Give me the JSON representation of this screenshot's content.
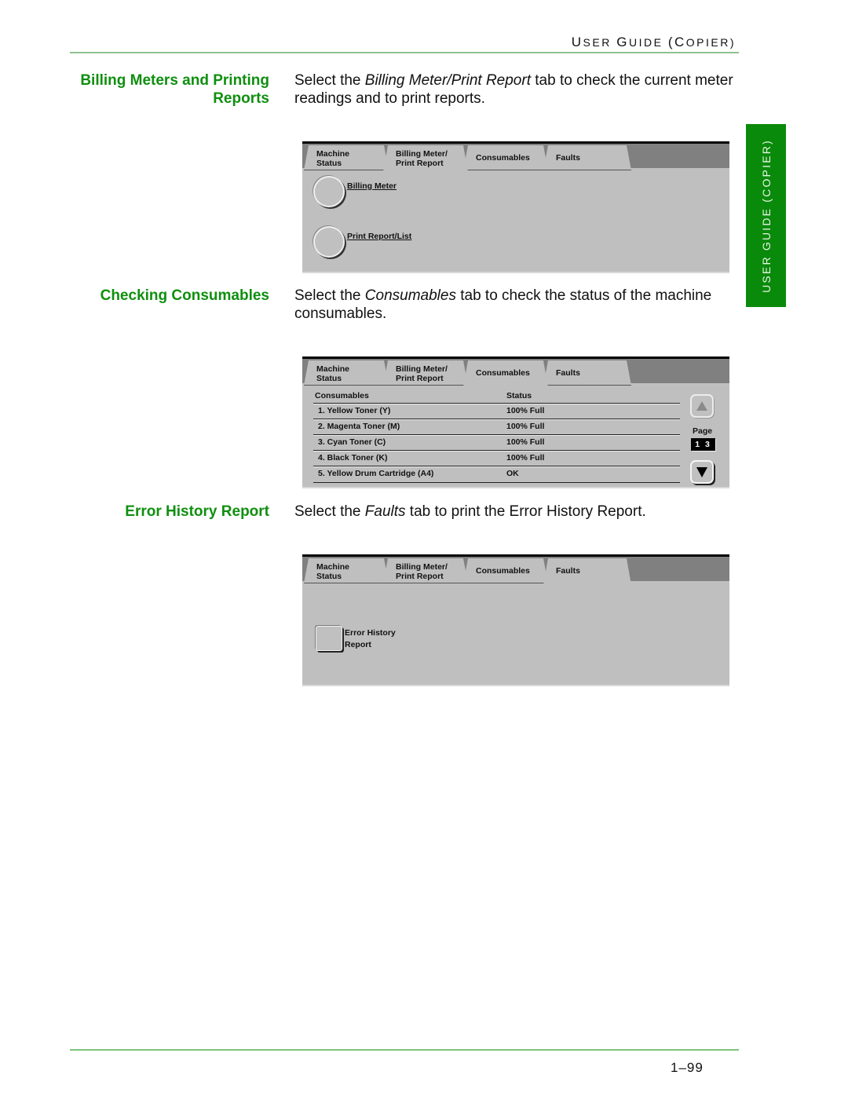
{
  "header": {
    "title": "USER GUIDE (COPIER)",
    "title_parts": [
      [
        "U",
        "SER "
      ],
      [
        "G",
        "UIDE "
      ],
      [
        "(C",
        "OPIER)"
      ]
    ]
  },
  "side_tab": {
    "label": "USER GUIDE (COPIER)"
  },
  "footer": {
    "page_number": "1–99"
  },
  "sections": [
    {
      "heading_line1": "Billing Meters and Printing",
      "heading_line2": "Reports",
      "body_pre": "Select the ",
      "body_em": "Billing Meter/Print Report",
      "body_post": " tab to check the current meter readings and to print reports."
    },
    {
      "heading_line1": "Checking Consumables",
      "body_pre": "Select the ",
      "body_em": "Consumables",
      "body_post": " tab to check the status of the machine consumables."
    },
    {
      "heading_line1": "Error History Report",
      "body_pre": "Select the ",
      "body_em": "Faults",
      "body_post": " tab to print the Error History Report."
    }
  ],
  "tabs": [
    {
      "line1": "Machine",
      "line2": "Status"
    },
    {
      "line1": "Billing Meter/",
      "line2": "Print Report"
    },
    {
      "line1": "Consumables"
    },
    {
      "line1": "Faults"
    }
  ],
  "panel1": {
    "buttons": [
      {
        "label": "Billing Meter"
      },
      {
        "label": "Print Report/List"
      }
    ]
  },
  "panel2": {
    "col_consumables": "Consumables",
    "col_status": "Status",
    "rows": [
      {
        "name": "1. Yellow Toner (Y)",
        "status": "100% Full"
      },
      {
        "name": "2. Magenta Toner (M)",
        "status": "100% Full"
      },
      {
        "name": "3. Cyan Toner (C)",
        "status": "100% Full"
      },
      {
        "name": "4. Black Toner (K)",
        "status": "100% Full"
      },
      {
        "name": "5. Yellow Drum Cartridge (A4)",
        "status": "OK"
      }
    ],
    "page_label": "Page",
    "page_value": "1 3"
  },
  "panel3": {
    "button_line1": "Error History",
    "button_line2": "Report"
  },
  "colors": {
    "heading_green": "#0f8f0f",
    "side_tab_green": "#0a8a0a",
    "panel_gray": "#bfbfbf",
    "tabbar_gray": "#808080"
  }
}
